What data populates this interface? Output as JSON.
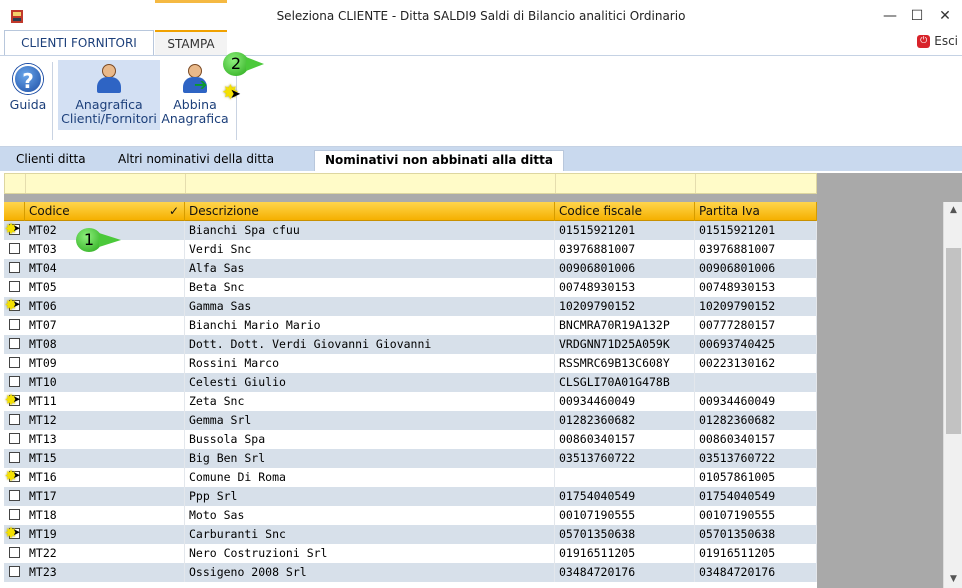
{
  "window": {
    "title": "Seleziona CLIENTE  - Ditta SALDI9 Saldi di Bilancio analitici Ordinario",
    "minimize": "—",
    "maximize": "☐",
    "close": "✕"
  },
  "ribbon_tabs": [
    {
      "label": "CLIENTI FORNITORI",
      "active": true
    },
    {
      "label": "STAMPA",
      "active": false
    }
  ],
  "esci_label": "Esci",
  "ribbon_buttons": {
    "guida": "Guida",
    "anagrafica_l1": "Anagrafica",
    "anagrafica_l2": "Clienti/Fornitori",
    "abbina_l1": "Abbina",
    "abbina_l2": "Anagrafica"
  },
  "callouts": {
    "one": "1",
    "two": "2"
  },
  "sub_tabs": [
    {
      "label": "Clienti ditta"
    },
    {
      "label": "Altri nominativi della ditta"
    },
    {
      "label": "Nominativi non abbinati alla ditta",
      "active": true
    }
  ],
  "columns": {
    "codice": "Codice",
    "sort_mark": "✓",
    "descrizione": "Descrizione",
    "codice_fiscale": "Codice fiscale",
    "partita_iva": "Partita Iva"
  },
  "rows": [
    {
      "codice": "MT02",
      "descrizione": "Bianchi Spa cfuu",
      "cf": "01515921201",
      "piva": "01515921201",
      "cursor": true
    },
    {
      "codice": "MT03",
      "descrizione": "Verdi Snc",
      "cf": "03976881007",
      "piva": "03976881007"
    },
    {
      "codice": "MT04",
      "descrizione": "Alfa Sas",
      "cf": "00906801006",
      "piva": "00906801006"
    },
    {
      "codice": "MT05",
      "descrizione": "Beta Snc",
      "cf": "00748930153",
      "piva": "00748930153"
    },
    {
      "codice": "MT06",
      "descrizione": "Gamma Sas",
      "cf": "10209790152",
      "piva": "10209790152",
      "cursor": true
    },
    {
      "codice": "MT07",
      "descrizione": "Bianchi Mario Mario",
      "cf": "BNCMRA70R19A132P",
      "piva": "00777280157"
    },
    {
      "codice": "MT08",
      "descrizione": "Dott. Dott. Verdi Giovanni Giovanni",
      "cf": "VRDGNN71D25A059K",
      "piva": "00693740425"
    },
    {
      "codice": "MT09",
      "descrizione": "Rossini Marco",
      "cf": "RSSMRC69B13C608Y",
      "piva": "00223130162"
    },
    {
      "codice": "MT10",
      "descrizione": "Celesti Giulio",
      "cf": "CLSGLI70A01G478B",
      "piva": ""
    },
    {
      "codice": "MT11",
      "descrizione": "Zeta Snc",
      "cf": "00934460049",
      "piva": "00934460049",
      "cursor": true
    },
    {
      "codice": "MT12",
      "descrizione": "Gemma Srl",
      "cf": "01282360682",
      "piva": "01282360682"
    },
    {
      "codice": "MT13",
      "descrizione": "Bussola Spa",
      "cf": "00860340157",
      "piva": "00860340157"
    },
    {
      "codice": "MT15",
      "descrizione": "Big Ben Srl",
      "cf": "03513760722",
      "piva": "03513760722"
    },
    {
      "codice": "MT16",
      "descrizione": "Comune Di Roma",
      "cf": "",
      "piva": "01057861005",
      "cursor": true
    },
    {
      "codice": "MT17",
      "descrizione": "Ppp Srl",
      "cf": "01754040549",
      "piva": "01754040549"
    },
    {
      "codice": "MT18",
      "descrizione": "Moto Sas",
      "cf": "00107190555",
      "piva": "00107190555"
    },
    {
      "codice": "MT19",
      "descrizione": "Carburanti Snc",
      "cf": "05701350638",
      "piva": "05701350638",
      "cursor": true
    },
    {
      "codice": "MT22",
      "descrizione": "Nero Costruzioni Srl",
      "cf": "01916511205",
      "piva": "01916511205"
    },
    {
      "codice": "MT23",
      "descrizione": "Ossigeno 2008 Srl",
      "cf": "03484720176",
      "piva": "03484720176"
    }
  ],
  "colors": {
    "accent": "#1c3f7a",
    "header": "#f5b000",
    "alt_row": "#d7e0ea",
    "filter_bg": "#fffbc8"
  }
}
